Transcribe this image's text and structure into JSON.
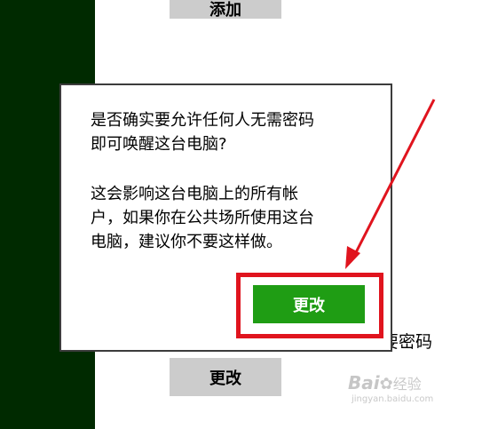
{
  "background": {
    "add_button_label": "添加",
    "change_button_label": "更改",
    "trailing_text": "要密码"
  },
  "dialog": {
    "question_line1": "是否确实要允许任何人无需密码",
    "question_line2": "即可唤醒这台电脑?",
    "info_line1": "这会影响这台电脑上的所有帐",
    "info_line2": "户，如果你在公共场所使用这台",
    "info_line3": "电脑，建议你不要这样做。",
    "confirm_label": "更改"
  },
  "watermark": {
    "brand": "Bai",
    "brand_suffix": "经验",
    "site": "jingyan.baidu.com"
  },
  "colors": {
    "sidebar": "#002a00",
    "confirm": "#1f9d14",
    "highlight": "#e0141e"
  }
}
